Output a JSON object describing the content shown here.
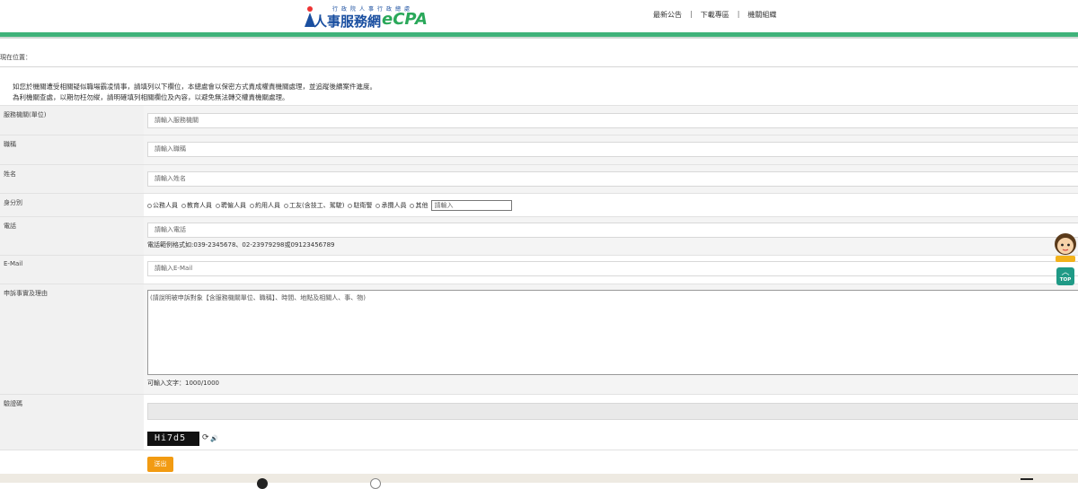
{
  "header": {
    "logo_sub": "行政院人事行政總處",
    "logo_main": "人事服務網",
    "logo_ecpa": "eCPA",
    "nav": [
      "最新公告",
      "下載專區",
      "機關組織"
    ],
    "nav_sep": "|"
  },
  "breadcrumb": "現在位置：",
  "intro": {
    "line1": "如您於機關遭受相關疑似職場霸凌情事，請填列以下欄位，本總處會以保密方式責成權責機關處理，並追蹤後續案件進度。",
    "line2": "為利機關查處，以期勿枉勿縱，請明確填列相關欄位及內容，以避免無法轉交權責機關處理。"
  },
  "form": {
    "agency": {
      "label": "服務機關(單位)",
      "placeholder": "請輸入服務機關"
    },
    "title": {
      "label": "職稱",
      "placeholder": "請輸入職稱"
    },
    "name": {
      "label": "姓名",
      "placeholder": "請輸入姓名"
    },
    "identity": {
      "label": "身分別",
      "options": [
        "公務人員",
        "教育人員",
        "聘僱人員",
        "約用人員",
        "工友(含技工、駕駛)",
        "駐衛警",
        "承攬人員",
        "其他"
      ],
      "other_placeholder": "請輸入"
    },
    "phone": {
      "label": "電話",
      "placeholder": "請輸入電話",
      "hint": "電話範例格式如:039-2345678、02-23979298或09123456789"
    },
    "email": {
      "label": "E-Mail",
      "placeholder": "請輸入E-Mail"
    },
    "complaint": {
      "label": "申訴事實及理由",
      "placeholder": "(請說明被申訴對象【含服務機關單位、職稱】、時間、地點及相關人、事、物)",
      "remaining": "可輸入文字：1000/1000"
    },
    "captcha": {
      "label": "驗證碼",
      "code": "Hi7d5",
      "refresh_icon": "⟳",
      "audio_icon": "🔊"
    },
    "submit_label": "送出"
  },
  "side": {
    "top_label": "TOP",
    "top_icon": "︿"
  }
}
